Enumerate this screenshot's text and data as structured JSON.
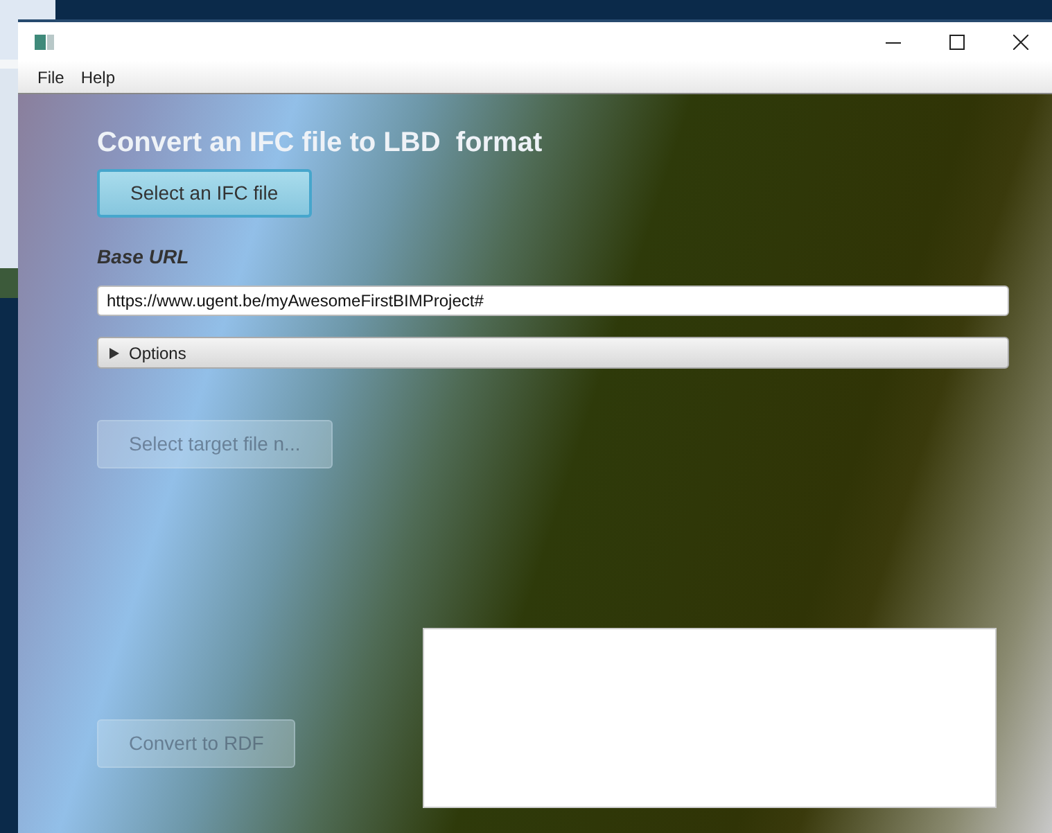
{
  "menu": [
    {
      "label": "File"
    },
    {
      "label": "Help"
    }
  ],
  "heading": "Convert an IFC file to LBD  format",
  "select_ifc_button": {
    "label": "Select an IFC file",
    "disabled": false
  },
  "base_url": {
    "label": "Base URL",
    "value": "https://www.ugent.be/myAwesomeFirstBIMProject#"
  },
  "options": {
    "label": "Options",
    "expanded": false
  },
  "target_button": {
    "label": "Select target file n...",
    "disabled": true
  },
  "convert_button": {
    "label": "Convert to RDF",
    "disabled": true
  }
}
